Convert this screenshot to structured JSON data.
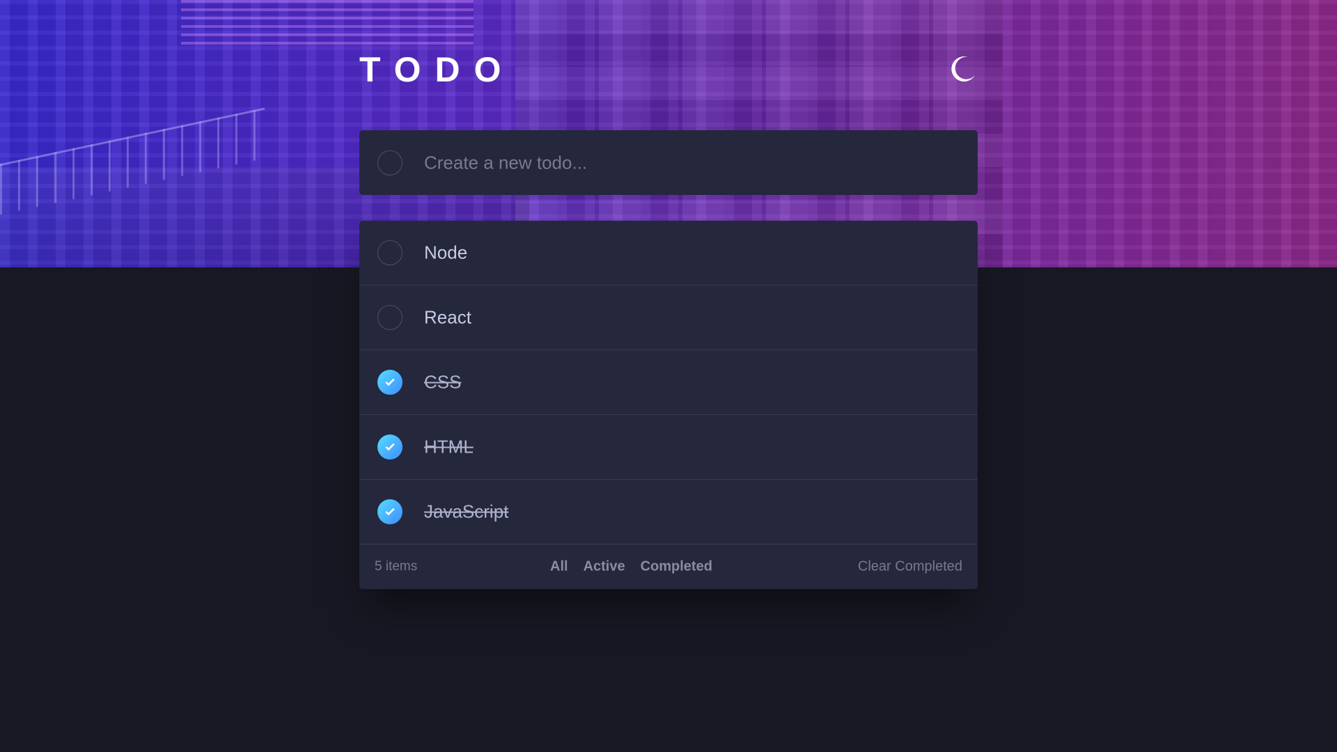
{
  "app": {
    "title": "TODO",
    "theme_icon": "moon-icon"
  },
  "colors": {
    "background": "#181824",
    "card": "#25273c",
    "hero_gradient_start": "#3a2bd0",
    "hero_gradient_end": "#8f2a8c",
    "check_gradient_start": "#55ddff",
    "check_gradient_end": "#3f8cff",
    "text": "#c8cbe7",
    "muted": "#777a92"
  },
  "create": {
    "placeholder": "Create a new todo..."
  },
  "todos": [
    {
      "label": "Node",
      "completed": false
    },
    {
      "label": "React",
      "completed": false
    },
    {
      "label": "CSS",
      "completed": true
    },
    {
      "label": "HTML",
      "completed": true
    },
    {
      "label": "JavaScript",
      "completed": true
    }
  ],
  "footer": {
    "count": "5 items",
    "filters": [
      "All",
      "Active",
      "Completed"
    ],
    "clear": "Clear Completed"
  }
}
